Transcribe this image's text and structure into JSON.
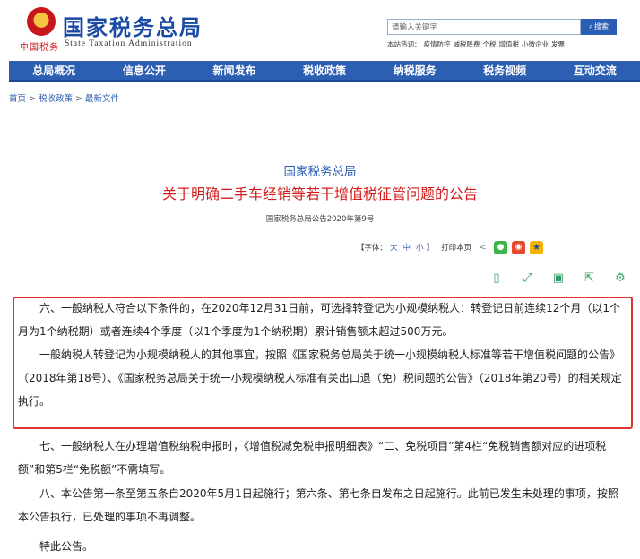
{
  "header": {
    "site_title": "国家税务总局",
    "site_subtitle": "State Taxation Administration",
    "tagline": "中国税务",
    "search_placeholder": "请输入关键字",
    "search_button": "搜索",
    "hot_label": "本站热词：",
    "hot_words": [
      "疫情防控",
      "减税降费",
      "个税",
      "增值税",
      "小微企业",
      "发票"
    ]
  },
  "nav": {
    "items": [
      "总局概况",
      "信息公开",
      "新闻发布",
      "税收政策",
      "纳税服务",
      "税务视频",
      "互动交流"
    ]
  },
  "breadcrumb": [
    "首页",
    "税收政策",
    "最新文件"
  ],
  "article": {
    "issuer": "国家税务总局",
    "title": "关于明确二手车经销等若干增值税征管问题的公告",
    "doc_no": "国家税务总局公告2020年第9号",
    "font_label": "【字体：",
    "font_sizes": [
      "大",
      "中",
      "小"
    ],
    "font_close": "】",
    "print_label": "打印本页"
  },
  "paragraphs": {
    "p1": "六、一般纳税人符合以下条件的，在2020年12月31日前，可选择转登记为小规模纳税人：转登记日前连续12个月（以1个月为1个纳税期）或者连续4个季度（以1个季度为1个纳税期）累计销售额未超过500万元。",
    "p2": "一般纳税人转登记为小规模纳税人的其他事宜，按照《国家税务总局关于统一小规模纳税人标准等若干增值税问题的公告》（2018年第18号）、《国家税务总局关于统一小规模纳税人标准有关出口退（免）税问题的公告》（2018年第20号）的相关规定执行。",
    "p3": "七、一般纳税人在办理增值税纳税申报时，《增值税减免税申报明细表》“二、免税项目”第4栏“免税销售额对应的进项税额”和第5栏“免税额”不需填写。",
    "p4": "八、本公告第一条至第五条自2020年5月1日起施行；第六条、第七条自发布之日起施行。此前已发生未处理的事项，按照本公告执行，已处理的事项不再调整。",
    "p5": "特此公告。"
  },
  "colors": {
    "brand_blue": "#2c5eb2",
    "title_red": "#d31b1b",
    "highlight_red": "#e0332b",
    "action_green": "#2f9e63"
  },
  "icons": [
    "emblem-icon",
    "search-icon",
    "share-icon",
    "wechat-icon",
    "weibo-icon",
    "qzone-icon",
    "mobile-icon",
    "fullscreen-icon",
    "save-icon",
    "export-icon",
    "settings-icon"
  ]
}
